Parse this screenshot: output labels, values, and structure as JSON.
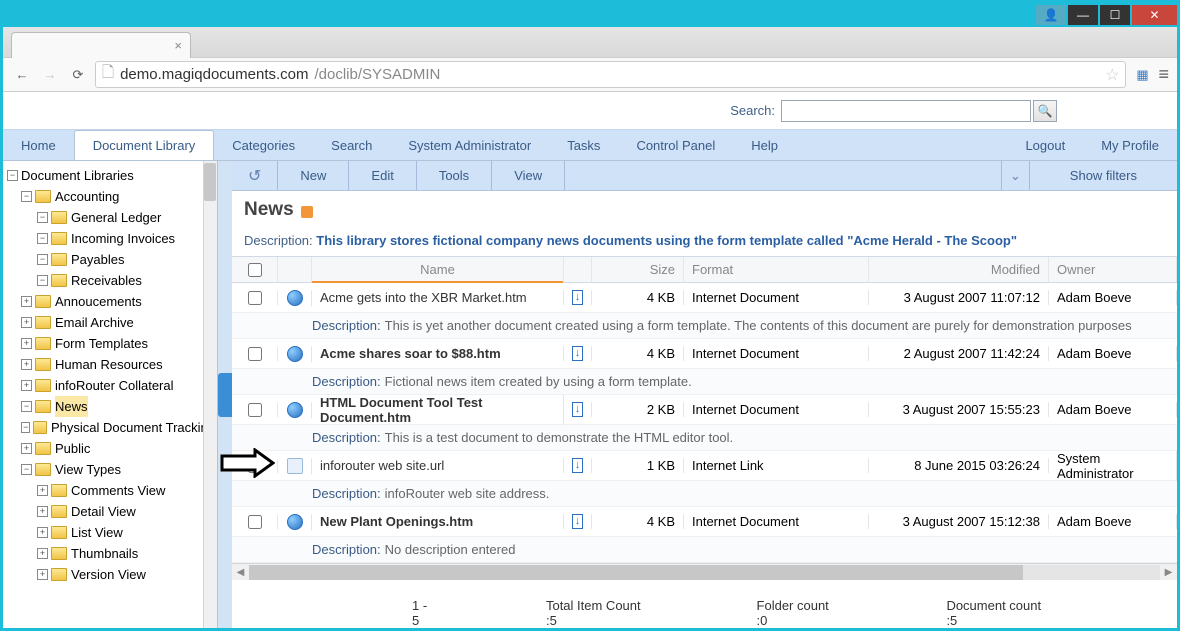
{
  "titlebar": {
    "user": "▲",
    "min": "—",
    "max": "☐",
    "close": "✕"
  },
  "browser": {
    "host": "demo.magiqdocuments.com",
    "path": "/doclib/SYSADMIN",
    "tab_close": "×"
  },
  "search": {
    "label": "Search:",
    "icon": "🔍"
  },
  "nav": {
    "items": [
      "Home",
      "Document Library",
      "Categories",
      "Search",
      "System Administrator",
      "Tasks",
      "Control Panel",
      "Help"
    ],
    "right": [
      "Logout",
      "My Profile"
    ]
  },
  "tree": {
    "root": "Document Libraries",
    "nodes": [
      {
        "pad": 1,
        "tog": "−",
        "label": "Accounting"
      },
      {
        "pad": 2,
        "tog": "−",
        "label": "General Ledger"
      },
      {
        "pad": 2,
        "tog": "−",
        "label": "Incoming Invoices"
      },
      {
        "pad": 2,
        "tog": "−",
        "label": "Payables"
      },
      {
        "pad": 2,
        "tog": "−",
        "label": "Receivables"
      },
      {
        "pad": 1,
        "tog": "+",
        "label": "Annoucements"
      },
      {
        "pad": 1,
        "tog": "+",
        "label": "Email Archive"
      },
      {
        "pad": 1,
        "tog": "+",
        "label": "Form Templates"
      },
      {
        "pad": 1,
        "tog": "+",
        "label": "Human Resources"
      },
      {
        "pad": 1,
        "tog": "+",
        "label": "infoRouter Collateral"
      },
      {
        "pad": 1,
        "tog": "−",
        "label": "News",
        "selected": true
      },
      {
        "pad": 1,
        "tog": "−",
        "label": "Physical Document Tracking"
      },
      {
        "pad": 1,
        "tog": "+",
        "label": "Public"
      },
      {
        "pad": 1,
        "tog": "−",
        "label": "View Types"
      },
      {
        "pad": 2,
        "tog": "+",
        "label": "Comments View"
      },
      {
        "pad": 2,
        "tog": "+",
        "label": "Detail View"
      },
      {
        "pad": 2,
        "tog": "+",
        "label": "List View"
      },
      {
        "pad": 2,
        "tog": "+",
        "label": "Thumbnails"
      },
      {
        "pad": 2,
        "tog": "+",
        "label": "Version View"
      }
    ]
  },
  "toolbar": {
    "back": "↺",
    "items": [
      "New",
      "Edit",
      "Tools",
      "View"
    ],
    "show_filters": "Show filters"
  },
  "page": {
    "title": "News",
    "desc_label": "Description:",
    "desc_text": "This library stores fictional company news documents using the form template called \"Acme Herald - The Scoop\""
  },
  "columns": {
    "name": "Name",
    "size": "Size",
    "format": "Format",
    "modified": "Modified",
    "owner": "Owner"
  },
  "rows": [
    {
      "bold": false,
      "type": "ie",
      "name": "Acme gets into the XBR Market.htm",
      "size": "4 KB",
      "format": "Internet Document",
      "modified": "3 August 2007 11:07:12",
      "owner": "Adam Boeve",
      "desc": "This is yet another document created using a form template. The contents of this document are purely for demonstration purposes"
    },
    {
      "bold": true,
      "type": "ie",
      "name": "Acme shares soar to $88.htm",
      "size": "4 KB",
      "format": "Internet Document",
      "modified": "2 August 2007 11:42:24",
      "owner": "Adam Boeve",
      "desc": "Fictional news item created by using a form template."
    },
    {
      "bold": true,
      "type": "ie",
      "name": "HTML Document Tool Test Document.htm",
      "size": "2 KB",
      "format": "Internet Document",
      "modified": "3 August 2007 15:55:23",
      "owner": "Adam Boeve",
      "desc": "This is a test document to demonstrate the HTML editor tool."
    },
    {
      "bold": false,
      "type": "link",
      "name": "inforouter web site.url",
      "size": "1 KB",
      "format": "Internet Link",
      "modified": "8 June 2015 03:26:24",
      "owner": "System Administrator",
      "desc": "infoRouter web site address."
    },
    {
      "bold": true,
      "type": "ie",
      "name": "New Plant Openings.htm",
      "size": "4 KB",
      "format": "Internet Document",
      "modified": "3 August 2007 15:12:38",
      "owner": "Adam Boeve",
      "desc": "No description entered"
    }
  ],
  "desc_label": "Description:",
  "footer": {
    "range": "1 - 5",
    "total": "Total Item Count :5",
    "folder": "Folder count :0",
    "doc": "Document count :5"
  }
}
